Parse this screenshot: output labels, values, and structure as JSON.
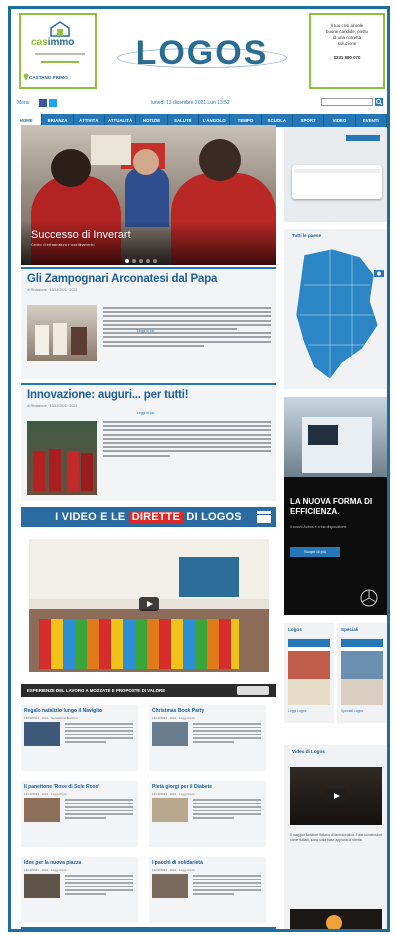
{
  "header": {
    "left_ad": {
      "brand": "immo",
      "brand_prefix": "cas",
      "tagline": "CASTANO PRIMO"
    },
    "logo": "LOGOS",
    "right_ad": {
      "line1": "Il tuo crisi al sole",
      "line2": "buone candide, posto",
      "line3": "di una corretta",
      "line4": "soluzione",
      "phone": "0331 880 070"
    }
  },
  "topbar": {
    "date": "lunedì 13 dicembre 2021 Lun 13:52"
  },
  "nav": [
    "HOME",
    "BRIANZA",
    "ATTIVITÀ",
    "ATTUALITÀ",
    "NOTIZIE",
    "SALUTE",
    "L'ANGOLO",
    "TEMPO LIBERO",
    "SCUOLA",
    "SPORT",
    "VIDEO",
    "EVENTI"
  ],
  "hero": {
    "title": "Successo di Inverart",
    "caption": "Centro di infrastruttura e coordinamento"
  },
  "article1": {
    "title": "Gli Zampognari Arconatesi dal Papa",
    "meta": "di Redazione · 13/12/2021 · 2021",
    "link": "Leggi di più"
  },
  "article2": {
    "title": "Innovazione: auguri... per tutti!",
    "meta": "di Redazione · 13/12/2021 · 2021",
    "link": "Leggi di più"
  },
  "video_banner": {
    "part1": "I VIDEO E LE",
    "part2": "DIRETTE",
    "part3": "DI LOGOS"
  },
  "video_caption": "ESPERIENZE DEL LAVORO A MOZZATE E PROPOSTE DI VALORE",
  "small_cards": [
    {
      "title": "Regalo natalizio lungo il Naviglio",
      "meta": "13/12/2021 · 2021 · Sebastiano Buzzoni"
    },
    {
      "title": "Christmas Book Party",
      "meta": "13/12/2021 · 2021 · Leggi di più"
    },
    {
      "title": "Il panettone 'Rose di Sole Rose'",
      "meta": "13/12/2021 · 2021 · Leggi di più"
    },
    {
      "title": "Pietà giorgi per il Diabete",
      "meta": "13/12/2021 · 2021 · Leggi di più"
    },
    {
      "title": "Idee per la nuova piazza",
      "meta": "13/12/2021 · 2021 · Leggi di più"
    },
    {
      "title": "I pacchi di solidarietà",
      "meta": "13/12/2021 · 2021 · Leggi di più"
    }
  ],
  "sidebar": {
    "map_box": "Tutti le paese",
    "ad_headline": "LA NUOVA FORMA DI EFFICIENZA.",
    "ad_sub": "Il nuovo Actros è a tua disposizione.",
    "ad_button": "Scopri di più",
    "logos_box": "Logos",
    "speciali_box": "Speciali",
    "logos_caption": "Leggi Logos",
    "speciali_caption": "Speciali Logos",
    "video_box": "Video di Logos",
    "video_text": "Il maggior fornitore italiano di farmaceutica. Tutte concessioni come Italiani, sono sulla base approva la stretta."
  },
  "colors": {
    "brand_blue": "#2577b5",
    "dark_blue": "#1e5f99",
    "frame": "#1d6f9b",
    "ad_green": "#8fc23f",
    "accent_red": "#e02a2a"
  }
}
